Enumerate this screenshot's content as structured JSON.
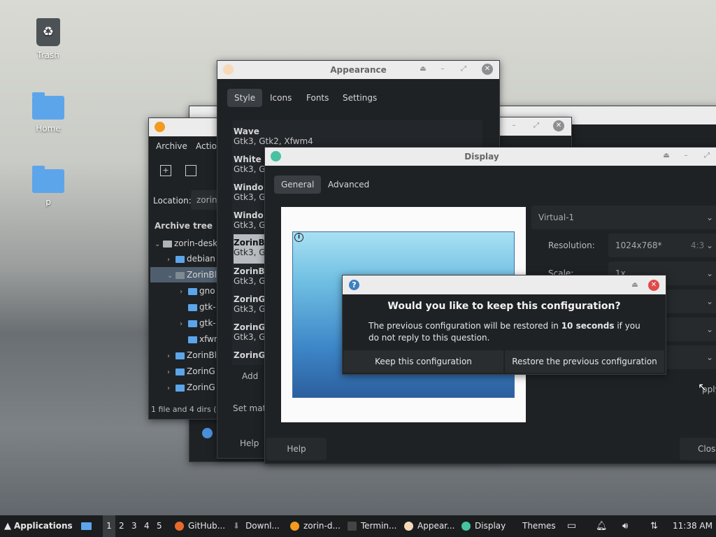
{
  "desktop": {
    "icons": [
      {
        "label": "Trash",
        "icon": "trash-icon"
      },
      {
        "label": "Home",
        "icon": "home-folder-icon"
      },
      {
        "label": "p",
        "icon": "folder-icon"
      }
    ]
  },
  "file_roller": {
    "menu": [
      "Archive",
      "Actio"
    ],
    "location_label": "Location:",
    "location_value": "zorin",
    "tree_header": "Archive tree",
    "tree": [
      "zorin-desk",
      "debian",
      "ZorinBl",
      "gno",
      "gtk-",
      "gtk-",
      "xfwr",
      "ZorinBl",
      "ZorinG",
      "ZorinG"
    ],
    "status": "1 file and 4 dirs  ("
  },
  "appearance": {
    "title": "Appearance",
    "tabs": [
      "Style",
      "Icons",
      "Fonts",
      "Settings"
    ],
    "themes": [
      {
        "name": "Wave",
        "desc": "Gtk3, Gtk2, Xfwm4"
      },
      {
        "name": "White",
        "desc": "Gtk3, G"
      },
      {
        "name": "Windo",
        "desc": "Gtk3, G"
      },
      {
        "name": "Windo",
        "desc": "Gtk3, G"
      },
      {
        "name": "ZorinB",
        "desc": "Gtk3, G"
      },
      {
        "name": "ZorinB",
        "desc": "Gtk3, G"
      },
      {
        "name": "ZorinG",
        "desc": "Gtk3, G"
      },
      {
        "name": "ZorinG",
        "desc": "Gtk3, G"
      },
      {
        "name": "ZorinG",
        "desc": ""
      }
    ],
    "add_label": "Add",
    "set_label": "Set mat",
    "help_label": "Help"
  },
  "display": {
    "title": "Display",
    "tabs": [
      "General",
      "Advanced"
    ],
    "output": "Virtual-1",
    "resolution_label": "Resolution:",
    "resolution_value": "1024x768*",
    "resolution_ratio": "4:3",
    "scale_label": "Scale:",
    "scale_value": "1x",
    "apply_label": "pply",
    "help_label": "Help",
    "close_label": "Clos"
  },
  "dialog": {
    "heading": "Would you like to keep this configuration?",
    "body_pre": "The previous configuration will be restored in ",
    "body_bold": "10 seconds",
    "body_post": " if you do not reply to this question.",
    "keep_label": "Keep this configuration",
    "restore_label": "Restore the previous configuration"
  },
  "taskbar": {
    "applications": "Applications",
    "workspaces": [
      "1",
      "2",
      "3",
      "4",
      "5"
    ],
    "tasks": [
      "GitHub...",
      "Downl...",
      "zorin-d...",
      "Termin...",
      "Appear...",
      "Display",
      "Themes"
    ],
    "clock": "11:38 AM"
  },
  "colors": {
    "accent_blue": "#3d7fc1",
    "close_red": "#e04a4a",
    "folder_blue": "#5da5ea"
  }
}
